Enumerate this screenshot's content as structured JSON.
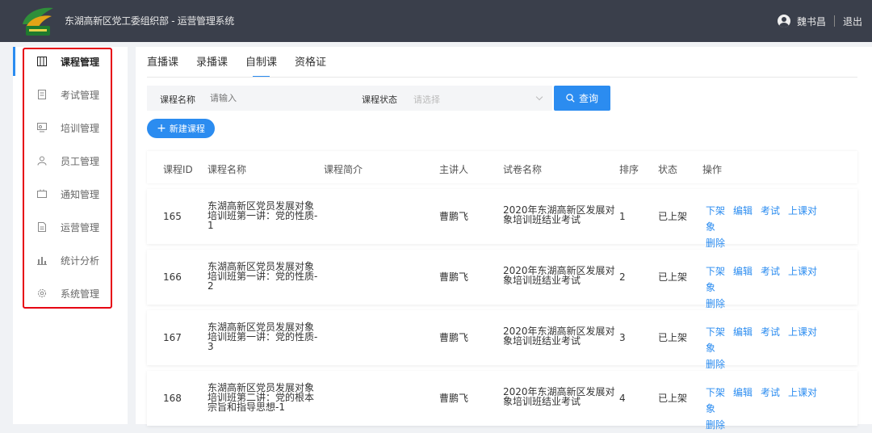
{
  "header": {
    "app_title": "东湖高新区党工委组织部 - 运营管理系统",
    "user_name": "魏书昌",
    "logout_label": "退出"
  },
  "sidebar": {
    "items": [
      {
        "label": "课程管理",
        "icon": "book-icon",
        "active": true
      },
      {
        "label": "考试管理",
        "icon": "document-icon"
      },
      {
        "label": "培训管理",
        "icon": "training-icon"
      },
      {
        "label": "员工管理",
        "icon": "user-icon"
      },
      {
        "label": "通知管理",
        "icon": "notice-icon"
      },
      {
        "label": "运营管理",
        "icon": "file-icon"
      },
      {
        "label": "统计分析",
        "icon": "bar-chart-icon"
      },
      {
        "label": "系统管理",
        "icon": "gear-icon"
      }
    ]
  },
  "tabs": [
    "直播课",
    "录播课",
    "自制课",
    "资格证"
  ],
  "active_tab": "自制课",
  "filter": {
    "name_label": "课程名称",
    "name_placeholder": "请输入",
    "status_label": "课程状态",
    "status_placeholder": "请选择",
    "query_label": "查询"
  },
  "new_course_label": "新建课程",
  "table": {
    "headers": [
      "课程ID",
      "课程名称",
      "课程简介",
      "主讲人",
      "试卷名称",
      "排序",
      "状态",
      "操作"
    ],
    "rows": [
      {
        "id": "165",
        "name": [
          "东湖高新区党员发展对象",
          "培训班第一讲：党的性质-",
          "1"
        ],
        "intro": "",
        "speaker": "曹鹏飞",
        "paper": [
          "2020年东湖高新区发展对",
          "象培训班结业考试"
        ],
        "order": "1",
        "status": "已上架"
      },
      {
        "id": "166",
        "name": [
          "东湖高新区党员发展对象",
          "培训班第一讲：党的性质-",
          "2"
        ],
        "intro": "",
        "speaker": "曹鹏飞",
        "paper": [
          "2020年东湖高新区发展对",
          "象培训班结业考试"
        ],
        "order": "2",
        "status": "已上架"
      },
      {
        "id": "167",
        "name": [
          "东湖高新区党员发展对象",
          "培训班第一讲：党的性质-",
          "3"
        ],
        "intro": "",
        "speaker": "曹鹏飞",
        "paper": [
          "2020年东湖高新区发展对",
          "象培训班结业考试"
        ],
        "order": "3",
        "status": "已上架"
      },
      {
        "id": "168",
        "name": [
          "东湖高新区党员发展对象",
          "培训班第二讲：党的根本",
          "宗旨和指导思想-1"
        ],
        "intro": "",
        "speaker": "曹鹏飞",
        "paper": [
          "2020年东湖高新区发展对",
          "象培训班结业考试"
        ],
        "order": "4",
        "status": "已上架"
      }
    ],
    "actions": [
      "下架",
      "编辑",
      "考试",
      "上课对象",
      "删除"
    ]
  },
  "colors": {
    "header_bg": "#3a3f4b",
    "primary": "#2b8cf0",
    "highlight_border": "#e60012"
  }
}
